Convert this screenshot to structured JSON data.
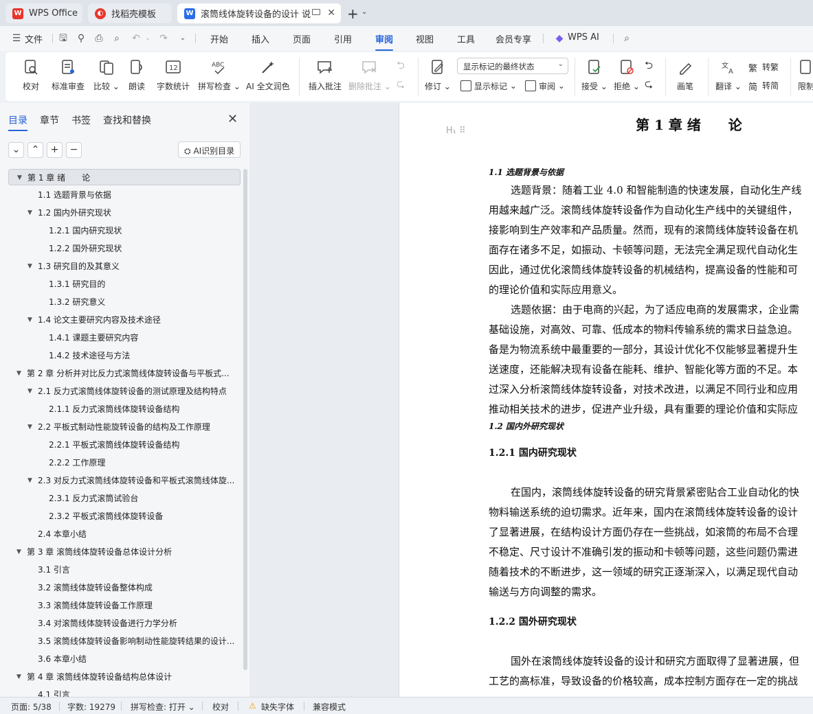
{
  "tabs": [
    {
      "label": "WPS Office",
      "icon": "wps-logo-icon"
    },
    {
      "label": "找稻壳模板",
      "icon": "docer-icon"
    },
    {
      "label": "滚筒线体旋转设备的设计 说明",
      "icon": "word-doc-icon"
    }
  ],
  "menu": {
    "file": "文件",
    "items": [
      "开始",
      "插入",
      "页面",
      "引用",
      "审阅",
      "视图",
      "工具",
      "会员专享"
    ],
    "active": "审阅",
    "ai": "WPS AI"
  },
  "ribbon": {
    "proofread": "校对",
    "standard_review": "标准审查",
    "compare": "比较",
    "read_aloud": "朗读",
    "word_count": "字数统计",
    "spell_check": "拼写检查",
    "ai_polish": "AI 全文润色",
    "insert_comment": "插入批注",
    "delete_comment": "删除批注",
    "track_changes": "修订",
    "markup_display": "显示标记的最终状态",
    "show_markup": "显示标记",
    "review": "审阅",
    "accept": "接受",
    "reject": "拒绝",
    "pen": "画笔",
    "translate": "翻译",
    "to_traditional": "转繁",
    "to_simplified": "转简",
    "restrict": "限制"
  },
  "nav": {
    "tabs": [
      "目录",
      "章节",
      "书签",
      "查找和替换"
    ],
    "active_tab": "目录",
    "ai_toc": "AI识别目录",
    "toc": [
      {
        "text": "第 1 章  绪　　论",
        "level": 1,
        "arrow": true,
        "selected": true
      },
      {
        "text": "1.1 选题背景与依据",
        "level": 2,
        "arrow": false
      },
      {
        "text": "1.2 国内外研究现状",
        "level": 2,
        "arrow": true
      },
      {
        "text": "1.2.1 国内研究现状",
        "level": 3,
        "arrow": false
      },
      {
        "text": "1.2.2 国外研究现状",
        "level": 3,
        "arrow": false
      },
      {
        "text": "1.3 研究目的及其意义",
        "level": 2,
        "arrow": true
      },
      {
        "text": "1.3.1 研究目的",
        "level": 3,
        "arrow": false
      },
      {
        "text": "1.3.2 研究意义",
        "level": 3,
        "arrow": false
      },
      {
        "text": "1.4  论文主要研究内容及技术途径",
        "level": 2,
        "arrow": true
      },
      {
        "text": "1.4.1  课题主要研究内容",
        "level": 3,
        "arrow": false
      },
      {
        "text": "1.4.2  技术途径与方法",
        "level": 3,
        "arrow": false
      },
      {
        "text": "第 2 章  分析并对比反力式滚筒线体旋转设备与平板式...",
        "level": 1,
        "arrow": true
      },
      {
        "text": "2.1  反力式滚筒线体旋转设备的测试原理及结构特点",
        "level": 2,
        "arrow": true
      },
      {
        "text": "2.1.1  反力式滚筒线体旋转设备结构",
        "level": 3,
        "arrow": false
      },
      {
        "text": "2.2  平板式制动性能旋转设备的结构及工作原理",
        "level": 2,
        "arrow": true
      },
      {
        "text": "2.2.1  平板式滚筒线体旋转设备结构",
        "level": 3,
        "arrow": false
      },
      {
        "text": "2.2.2  工作原理",
        "level": 3,
        "arrow": false
      },
      {
        "text": "2.3 对反力式滚筒线体旋转设备和平板式滚筒线体旋...",
        "level": 2,
        "arrow": true
      },
      {
        "text": "2.3.1  反力式滚筒试验台",
        "level": 3,
        "arrow": false
      },
      {
        "text": "2.3.2  平板式滚筒线体旋转设备",
        "level": 3,
        "arrow": false
      },
      {
        "text": "2.4  本章小结",
        "level": 2,
        "arrow": false
      },
      {
        "text": "第 3 章   滚筒线体旋转设备总体设计分析",
        "level": 1,
        "arrow": true
      },
      {
        "text": "3.1  引言",
        "level": 2,
        "arrow": false
      },
      {
        "text": "3.2 滚筒线体旋转设备整体构成",
        "level": 2,
        "arrow": false
      },
      {
        "text": "3.3  滚筒线体旋转设备工作原理",
        "level": 2,
        "arrow": false
      },
      {
        "text": "3.4  对滚筒线体旋转设备进行力学分析",
        "level": 2,
        "arrow": false
      },
      {
        "text": "3.5  滚筒线体旋转设备影响制动性能旋转结果的设计...",
        "level": 2,
        "arrow": false
      },
      {
        "text": "3.6  本章小结",
        "level": 2,
        "arrow": false
      },
      {
        "text": "第 4 章  滚筒线体旋转设备结构总体设计",
        "level": 1,
        "arrow": true
      },
      {
        "text": "4.1  引言",
        "level": 2,
        "arrow": false
      }
    ]
  },
  "doc": {
    "chapter_title": "第 1 章  绪　　论",
    "sec_1_1": "1.1  选题背景与依据",
    "p1": [
      "选题背景：随着工业 4.0 和智能制造的快速发展，自动化生产线",
      "用越来越广泛。滚筒线体旋转设备作为自动化生产线中的关键组件，",
      "接影响到生产效率和产品质量。然而，现有的滚筒线体旋转设备在机",
      "面存在诸多不足，如振动、卡顿等问题，无法完全满足现代自动化生",
      "因此，通过优化滚筒线体旋转设备的机械结构，提高设备的性能和可",
      "的理论价值和实际应用意义。"
    ],
    "p2": [
      "选题依据：由于电商的兴起，为了适应电商的发展需求，企业需",
      "基础设施，对高效、可靠、低成本的物料传输系统的需求日益急迫。",
      "备是为物流系统中最重要的一部分，其设计优化不仅能够显著提升生",
      "送速度，还能解决现有设备在能耗、维护、智能化等方面的不足。本",
      "过深入分析滚筒线体旋转设备，对技术改进，以满足不同行业和应用",
      "推动相关技术的进步，促进产业升级，具有重要的理论价值和实际应"
    ],
    "sec_1_2": "1.2  国内外研究现状",
    "sec_1_2_1": "1.2.1 国内研究现状",
    "p3": [
      "在国内，滚筒线体旋转设备的研究背景紧密贴合工业自动化的快",
      "物料输送系统的迫切需求。近年来，国内在滚筒线体旋转设备的设计",
      "了显著进展，在结构设计方面仍存在一些挑战，如滚筒的布局不合理",
      "不稳定、尺寸设计不准确引发的振动和卡顿等问题，这些问题仍需进",
      "随着技术的不断进步，这一领域的研究正逐渐深入，以满足现代自动",
      "输送与方向调整的需求。"
    ],
    "sec_1_2_2": "1.2.2 国外研究现状",
    "p4": [
      "国外在滚筒线体旋转设备的设计和研究方面取得了显著进展，但",
      "工艺的高标准，导致设备的价格较高，成本控制方面存在一定的挑战"
    ]
  },
  "status": {
    "page": "页面: 5/38",
    "words": "字数: 19279",
    "spell": "拼写检查: 打开",
    "proof": "校对",
    "missing_font": "缺失字体",
    "compat": "兼容模式"
  },
  "colors": {
    "accent": "#2563d8",
    "wps_red": "#e8352b",
    "word_blue": "#2b6de8",
    "warning": "#e8a317"
  }
}
